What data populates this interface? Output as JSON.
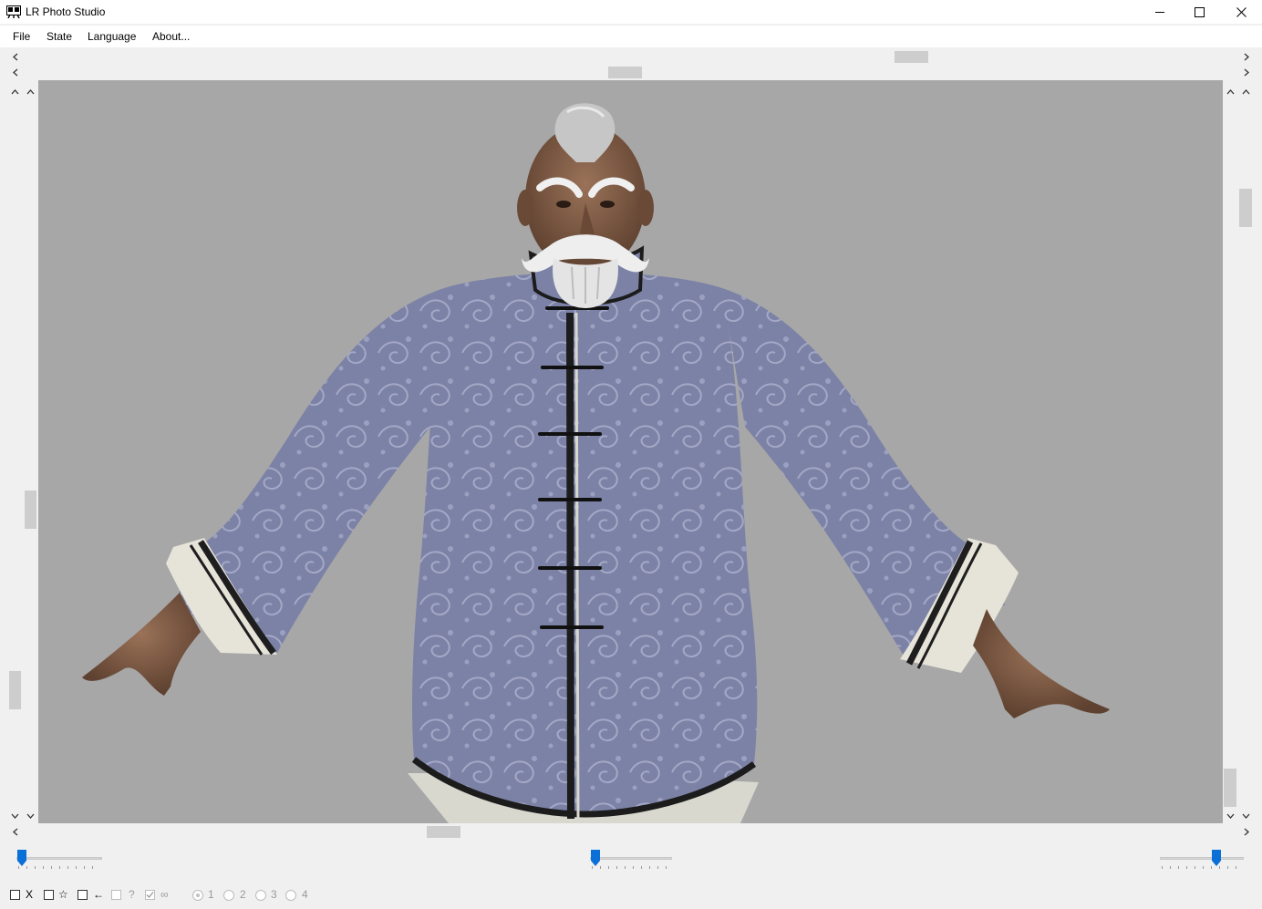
{
  "window": {
    "title": "LR Photo Studio",
    "icons": [
      "app-icon",
      "minimize-icon",
      "maximize-icon",
      "close-icon"
    ]
  },
  "menu": [
    {
      "label": "File"
    },
    {
      "label": "State"
    },
    {
      "label": "Language"
    },
    {
      "label": "About..."
    }
  ],
  "scrollbars": {
    "top_horizontal_1": {
      "position_fraction": 0.73
    },
    "top_horizontal_2": {
      "position_fraction": 0.49
    },
    "bottom_horizontal": {
      "position_fraction": 0.34
    },
    "left_vertical_1": {
      "position_fraction": 0.82
    },
    "left_vertical_2": {
      "position_fraction": 0.55
    },
    "right_vertical_1": {
      "position_fraction": 0.98
    },
    "right_vertical_2": {
      "position_fraction": 0.16
    }
  },
  "viewport": {
    "background": "#a7a7a7",
    "content": "3D character model: elderly martial artist in blue dragon-patterned Chinese jacket, T-pose"
  },
  "sliders": [
    {
      "name": "left-slider",
      "value_fraction": 0.0
    },
    {
      "name": "center-slider",
      "value_fraction": 0.0
    },
    {
      "name": "right-slider",
      "value_fraction": 0.7
    }
  ],
  "status": {
    "checks": [
      {
        "label": "X",
        "checked": false,
        "enabled": true
      },
      {
        "label": "☆",
        "checked": false,
        "enabled": true
      },
      {
        "label": "←",
        "checked": false,
        "enabled": true
      },
      {
        "label": "?",
        "checked": false,
        "enabled": false
      },
      {
        "label": "∞",
        "checked": true,
        "enabled": false
      }
    ],
    "radios": [
      {
        "label": "1",
        "selected": true
      },
      {
        "label": "2",
        "selected": false
      },
      {
        "label": "3",
        "selected": false
      },
      {
        "label": "4",
        "selected": false
      }
    ]
  },
  "colors": {
    "accent": "#0a6fd6",
    "window_bg": "#f0f0f0",
    "scroll_thumb": "#cdcdcd"
  }
}
